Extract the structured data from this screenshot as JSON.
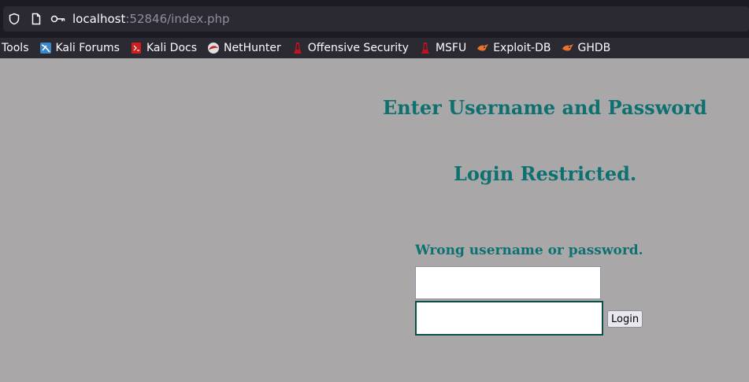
{
  "browser": {
    "url_host": "localhost",
    "url_rest": ":52846/index.php",
    "icons": [
      "shield-icon",
      "page-icon",
      "key-icon"
    ]
  },
  "bookmarks": [
    {
      "label": "Tools",
      "icon": ""
    },
    {
      "label": "Kali Forums",
      "icon": "kali-forums-icon"
    },
    {
      "label": "Kali Docs",
      "icon": "kali-docs-icon"
    },
    {
      "label": "NetHunter",
      "icon": "nethunter-icon"
    },
    {
      "label": "Offensive Security",
      "icon": "offsec-icon"
    },
    {
      "label": "MSFU",
      "icon": "msfu-icon"
    },
    {
      "label": "Exploit-DB",
      "icon": "exploitdb-icon"
    },
    {
      "label": "GHDB",
      "icon": "ghdb-icon"
    }
  ],
  "page": {
    "heading": "Enter Username and Password",
    "subheading": "Login Restricted.",
    "error_message": "Wrong username or password.",
    "username_value": "",
    "password_value": "",
    "login_button": "Login"
  },
  "colors": {
    "page_background": "#a9a7a8",
    "heading_teal": "#0e7171",
    "chrome_dark": "#1c1b22"
  }
}
